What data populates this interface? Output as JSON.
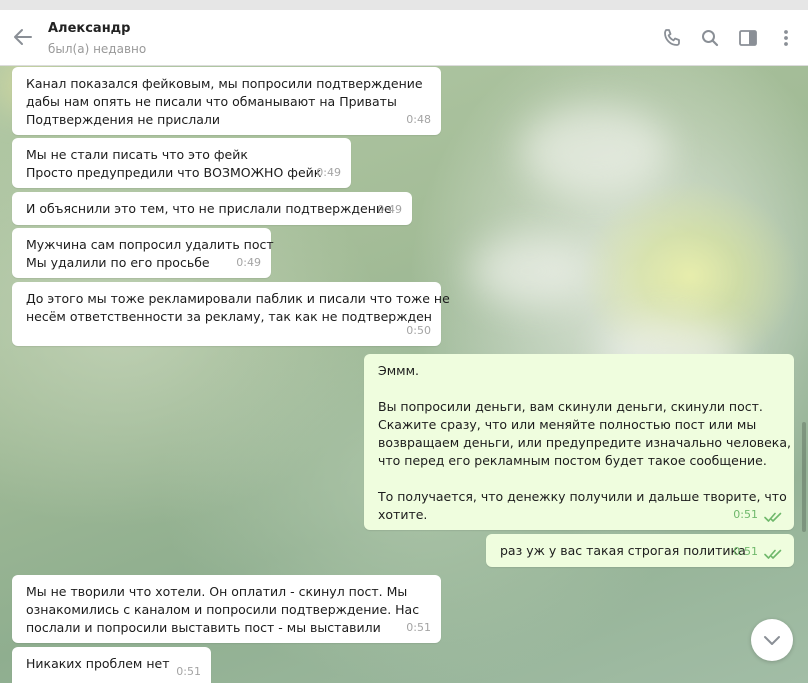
{
  "header": {
    "contact_name": "Александр",
    "contact_status": "был(а) недавно",
    "icons": [
      "back-arrow-icon",
      "phone-icon",
      "search-icon",
      "sidebar-toggle-icon",
      "more-vert-icon"
    ]
  },
  "messages": [
    {
      "direction": "in",
      "lines": [
        "Канал показался фейковым, мы попросили подтверждение",
        "дабы нам опять не писали что обманывают на Приваты",
        "Подтверждения не прислали"
      ],
      "time": "0:48"
    },
    {
      "direction": "in",
      "lines": [
        "Мы не стали писать что это фейк",
        "Просто предупредили что ВОЗМОЖНО фейк"
      ],
      "time": "0:49"
    },
    {
      "direction": "in",
      "lines": [
        "И объяснили это тем, что не прислали подтверждение"
      ],
      "time": "0:49"
    },
    {
      "direction": "in",
      "lines": [
        "Мужчина сам попросил удалить пост",
        "Мы удалили по его просьбе"
      ],
      "time": "0:49"
    },
    {
      "direction": "in",
      "lines": [
        "До этого мы тоже рекламировали паблик и писали что тоже не",
        "несём ответственности за рекламу, так как не подтвержден"
      ],
      "time": "0:50"
    },
    {
      "direction": "out",
      "lines": [
        "Эммм.",
        "",
        "Вы попросили деньги, вам скинули деньги, скинули пост.",
        "Скажите сразу, что или меняйте полностью пост или мы",
        "возвращаем деньги, или предупредите изначально человека,",
        "что перед его рекламным постом будет такое сообщение.",
        "",
        "То получается, что денежку получили и дальше творите, что",
        "хотите."
      ],
      "time": "0:51"
    },
    {
      "direction": "out",
      "lines": [
        "раз уж у вас такая строгая политика"
      ],
      "time": "0:51"
    },
    {
      "direction": "in",
      "lines": [
        "Мы не творили что хотели. Он оплатил - скинул пост. Мы",
        "ознакомились с каналом и попросили подтверждение. Нас",
        "послали и попросили выставить пост - мы выставили"
      ],
      "time": "0:51"
    },
    {
      "direction": "in",
      "lines": [
        "Никаких проблем нет"
      ],
      "time": "0:51"
    }
  ],
  "colors": {
    "incoming_bubble": "#ffffff",
    "outgoing_bubble": "#effdde",
    "read_ticks": "#6fb86b",
    "header_icons": "#8a8f96"
  }
}
